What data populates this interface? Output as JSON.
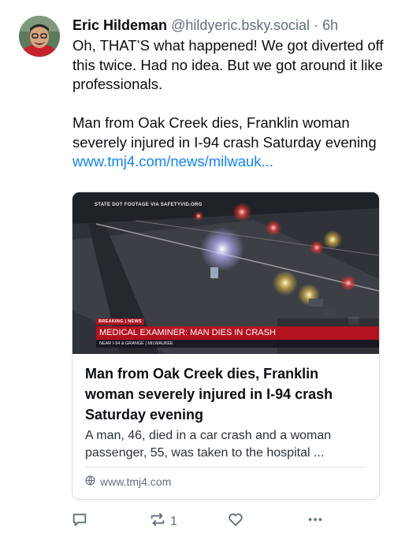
{
  "post": {
    "author_name": "Eric Hildeman",
    "author_handle": "@hildyeric.bsky.social",
    "separator": "·",
    "time": "6h",
    "text_line_1": "Oh, THAT’S what happened! We got diverted off this twice. Had no idea. But we got around it like professionals.",
    "text_line_2": "Man from Oak Creek dies, Franklin woman severely injured in I-94 crash Saturday evening",
    "link_text": "www.tmj4.com/news/milwauk..."
  },
  "embed": {
    "thumb_source": "STATE DOT FOOTAGE VIA SAFETYVID.ORG",
    "breaking_label": "BREAKING | NEWS",
    "banner_text": "MEDICAL EXAMINER: MAN DIES IN CRASH",
    "sub_banner_text": "NEAR I-94 & GRANGE | MILWAUKEE",
    "title": "Man from Oak Creek dies, Franklin woman severely injured in I-94 crash Saturday evening",
    "description": "A man, 46, died in a car crash and a woman passenger, 55, was taken to the hospital ...",
    "domain": "www.tmj4.com"
  },
  "actions": {
    "repost_count": "1"
  },
  "colors": {
    "link": "#1083fe",
    "muted": "#5f6f80",
    "banner_red": "#b3121f"
  },
  "icons": [
    "globe-icon",
    "reply-icon",
    "repost-icon",
    "like-icon",
    "more-icon"
  ]
}
